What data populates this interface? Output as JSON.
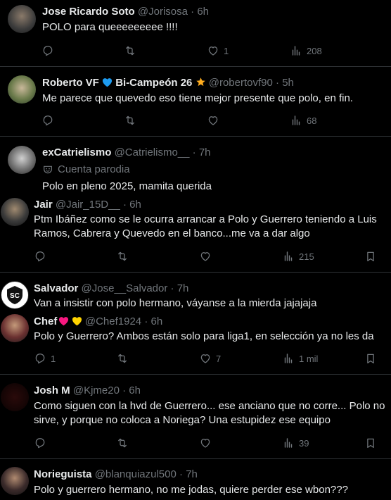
{
  "tweets": [
    {
      "name": "Jose Ricardo Soto",
      "handle": "@Jorisosa",
      "time": "6h",
      "text": "POLO para queeeeeeeee !!!!",
      "reply": "",
      "retweet": "",
      "like": "1",
      "views": "208"
    },
    {
      "name": "Roberto VF",
      "name_suffix": "Bi-Campeón 26",
      "handle": "@robertovf90",
      "time": "5h",
      "text": "Me parece que quevedo eso tiene mejor presente que polo, en fin.",
      "reply": "",
      "retweet": "",
      "like": "",
      "views": "68"
    },
    {
      "name": "exCatrielismo",
      "handle": "@Catrielismo__",
      "time": "7h",
      "badge": "Cuenta parodia",
      "text": "Polo en pleno 2025, mamita querida"
    },
    {
      "name": "Jair",
      "handle": "@Jair_15D__",
      "time": "6h",
      "text": "Ptm Ibáñez como se le ocurra arrancar a Polo y Guerrero teniendo a Luis Ramos, Cabrera y Quevedo en el banco...me va a dar algo",
      "reply": "",
      "retweet": "",
      "like": "",
      "views": "215"
    },
    {
      "name": "Salvador",
      "handle": "@Jose__Salvador",
      "time": "7h",
      "text": "Van a insistir con polo hermano, váyanse a la mierda jajajaja"
    },
    {
      "name": "Chef",
      "handle": "@Chef1924",
      "time": "6h",
      "text": "Polo y Guerrero? Ambos están solo para liga1, en selección ya no les da",
      "reply": "1",
      "retweet": "",
      "like": "7",
      "views": "1 mil"
    },
    {
      "name": "Josh M",
      "handle": "@Kjme20",
      "time": "6h",
      "text": "Como siguen con la hvd de Guerrero... ese anciano que no corre... Polo no sirve, y porque no  coloca a Noriega? Una estupidez ese equipo",
      "reply": "",
      "retweet": "",
      "like": "",
      "views": "39"
    },
    {
      "name": "Norieguista",
      "handle": "@blanquiazul500",
      "time": "7h",
      "text": "Polo y guerrero hermano, no me jodas, quiere perder ese wbon???"
    }
  ],
  "colors": {
    "background": "#000000",
    "text": "#e7e9ea",
    "muted": "#71767b",
    "separator": "#2f3336",
    "verified_heart": "#1d9bf0",
    "star": "#ffad1f",
    "red_heart": "#f91880",
    "yellow_heart": "#ffd400"
  },
  "icons": {
    "reply": "reply-icon",
    "retweet": "retweet-icon",
    "like": "like-icon",
    "views": "views-icon",
    "bookmark": "bookmark-icon",
    "parody": "parody-mask-icon"
  }
}
